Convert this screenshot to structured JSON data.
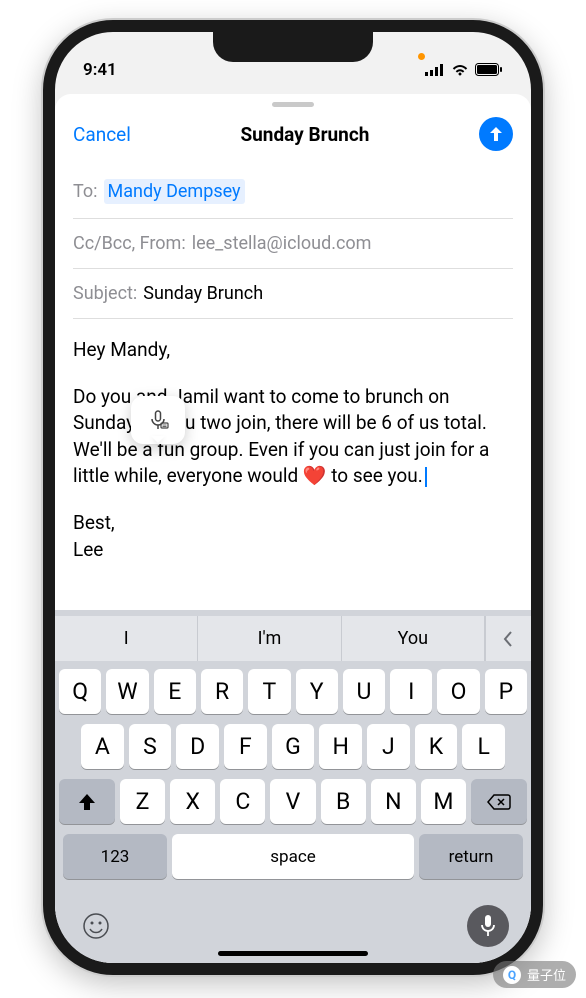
{
  "status": {
    "time": "9:41"
  },
  "nav": {
    "cancel": "Cancel",
    "title": "Sunday Brunch"
  },
  "compose": {
    "to_label": "To:",
    "to_recipient": "Mandy Dempsey",
    "ccbcc_label": "Cc/Bcc, From:",
    "from_value": "lee_stella@icloud.com",
    "subject_label": "Subject:",
    "subject_value": "Sunday Brunch",
    "body_greeting": "Hey Mandy,",
    "body_main": "Do you and Jamil want to come to brunch on Sunday? If you two join, there will be 6 of us total. We'll be a fun group. Even if you can just join for a little while, everyone would ❤️ to see you.",
    "body_closing": "Best,",
    "body_signature": "Lee"
  },
  "suggestions": {
    "s1": "I",
    "s2": "I'm",
    "s3": "You"
  },
  "keys": {
    "row1": [
      "Q",
      "W",
      "E",
      "R",
      "T",
      "Y",
      "U",
      "I",
      "O",
      "P"
    ],
    "row2": [
      "A",
      "S",
      "D",
      "F",
      "G",
      "H",
      "J",
      "K",
      "L"
    ],
    "row3": [
      "Z",
      "X",
      "C",
      "V",
      "B",
      "N",
      "M"
    ],
    "k123": "123",
    "space": "space",
    "return": "return"
  },
  "watermark": "量子位"
}
